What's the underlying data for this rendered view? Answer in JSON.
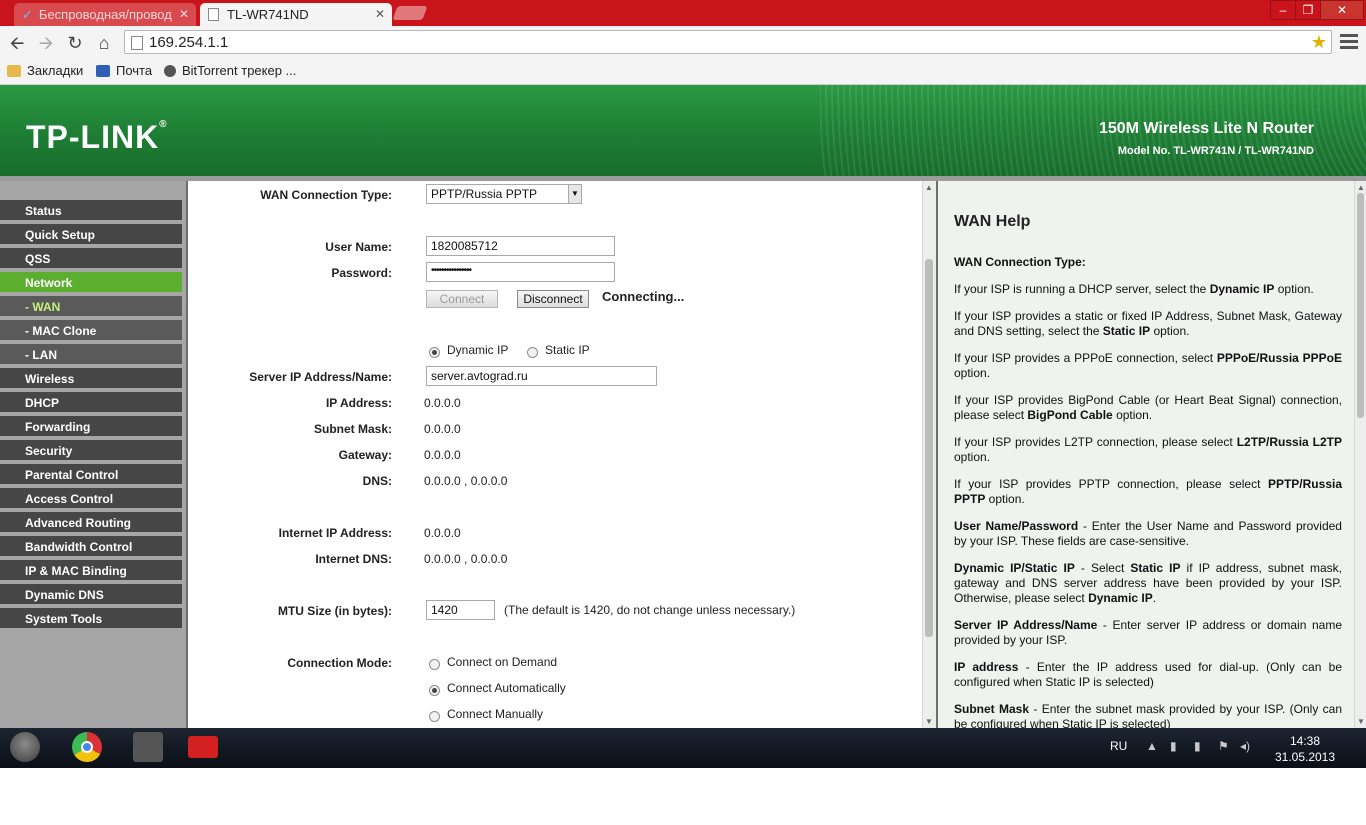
{
  "browser": {
    "tabs": [
      {
        "label": "Беспроводная/провод",
        "active": false
      },
      {
        "label": "TL-WR741ND",
        "active": true
      }
    ],
    "url": "169.254.1.1",
    "bookmarks": [
      "Закладки",
      "Почта",
      "BitTorrent трекер ..."
    ],
    "window_controls": [
      "–",
      "❐",
      "✕"
    ]
  },
  "banner": {
    "logo": "TP-LINK",
    "product": "150M Wireless Lite N Router",
    "model": "Model No. TL-WR741N / TL-WR741ND"
  },
  "sidebar": {
    "items": [
      {
        "label": "Status",
        "type": "main"
      },
      {
        "label": "Quick Setup",
        "type": "main"
      },
      {
        "label": "QSS",
        "type": "main"
      },
      {
        "label": "Network",
        "type": "active"
      },
      {
        "label": "- WAN",
        "type": "activesub"
      },
      {
        "label": "- MAC Clone",
        "type": "sub"
      },
      {
        "label": "- LAN",
        "type": "sub"
      },
      {
        "label": "Wireless",
        "type": "main"
      },
      {
        "label": "DHCP",
        "type": "main"
      },
      {
        "label": "Forwarding",
        "type": "main"
      },
      {
        "label": "Security",
        "type": "main"
      },
      {
        "label": "Parental Control",
        "type": "main"
      },
      {
        "label": "Access Control",
        "type": "main"
      },
      {
        "label": "Advanced Routing",
        "type": "main"
      },
      {
        "label": "Bandwidth Control",
        "type": "main"
      },
      {
        "label": "IP & MAC Binding",
        "type": "main"
      },
      {
        "label": "Dynamic DNS",
        "type": "main"
      },
      {
        "label": "System Tools",
        "type": "main"
      }
    ]
  },
  "form": {
    "wan_type_label": "WAN Connection Type:",
    "wan_type_value": "PPTP/Russia PPTP",
    "username_label": "User Name:",
    "username_value": "1820085712",
    "password_label": "Password:",
    "password_value": "••••••••••••••••",
    "connect_label": "Connect",
    "disconnect_label": "Disconnect",
    "status_text": "Connecting...",
    "dynamic_ip_label": "Dynamic IP",
    "static_ip_label": "Static IP",
    "ip_mode_selected": "Dynamic IP",
    "server_label": "Server IP Address/Name:",
    "server_value": "server.avtograd.ru",
    "ip_label": "IP Address:",
    "ip_value": "0.0.0.0",
    "mask_label": "Subnet Mask:",
    "mask_value": "0.0.0.0",
    "gateway_label": "Gateway:",
    "gateway_value": "0.0.0.0",
    "dns_label": "DNS:",
    "dns_value": "0.0.0.0 , 0.0.0.0",
    "inet_ip_label": "Internet IP Address:",
    "inet_ip_value": "0.0.0.0",
    "inet_dns_label": "Internet DNS:",
    "inet_dns_value": "0.0.0.0 , 0.0.0.0",
    "mtu_label": "MTU Size (in bytes):",
    "mtu_value": "1420",
    "mtu_note": "(The default is 1420, do not change unless necessary.)",
    "conn_mode_label": "Connection Mode:",
    "conn_modes": [
      "Connect on Demand",
      "Connect Automatically",
      "Connect Manually"
    ],
    "conn_mode_selected": "Connect Automatically"
  },
  "help": {
    "title": "WAN Help",
    "paragraphs": [
      [
        {
          "t": "WAN Connection Type:",
          "b": true
        }
      ],
      [
        {
          "t": "If your ISP is running a DHCP server, select the "
        },
        {
          "t": "Dynamic IP",
          "b": true
        },
        {
          "t": " option."
        }
      ],
      [
        {
          "t": "If your ISP provides a static or fixed IP Address, Subnet Mask, Gateway and DNS setting, select the "
        },
        {
          "t": "Static IP",
          "b": true
        },
        {
          "t": " option."
        }
      ],
      [
        {
          "t": "If your ISP provides a PPPoE connection, select "
        },
        {
          "t": "PPPoE/Russia PPPoE",
          "b": true
        },
        {
          "t": " option."
        }
      ],
      [
        {
          "t": "If your ISP provides BigPond Cable (or Heart Beat Signal) connection, please select "
        },
        {
          "t": "BigPond Cable",
          "b": true
        },
        {
          "t": " option."
        }
      ],
      [
        {
          "t": "If your ISP provides L2TP connection, please select "
        },
        {
          "t": "L2TP/Russia L2TP",
          "b": true
        },
        {
          "t": " option."
        }
      ],
      [
        {
          "t": "If your ISP provides PPTP connection, please select "
        },
        {
          "t": "PPTP/Russia PPTP",
          "b": true
        },
        {
          "t": " option."
        }
      ],
      [
        {
          "t": "User Name/Password",
          "b": true
        },
        {
          "t": " - Enter the User Name and Password provided by your ISP. These fields are case-sensitive."
        }
      ],
      [
        {
          "t": "Dynamic IP/Static IP",
          "b": true
        },
        {
          "t": " - Select "
        },
        {
          "t": "Static IP",
          "b": true
        },
        {
          "t": " if IP address, subnet mask, gateway and DNS server address have been provided by your ISP. Otherwise, please select "
        },
        {
          "t": "Dynamic IP",
          "b": true
        },
        {
          "t": "."
        }
      ],
      [
        {
          "t": "Server IP Address/Name",
          "b": true
        },
        {
          "t": " - Enter server IP address or domain name provided by your ISP."
        }
      ],
      [
        {
          "t": "IP address",
          "b": true
        },
        {
          "t": " - Enter the IP address used for dial-up. (Only can be configured when Static IP is selected)"
        }
      ],
      [
        {
          "t": "Subnet Mask",
          "b": true
        },
        {
          "t": " - Enter the subnet mask provided by your ISP. (Only can be configured when Static IP is selected)"
        }
      ]
    ]
  },
  "taskbar": {
    "lang": "RU",
    "time": "14:38",
    "date": "31.05.2013"
  }
}
